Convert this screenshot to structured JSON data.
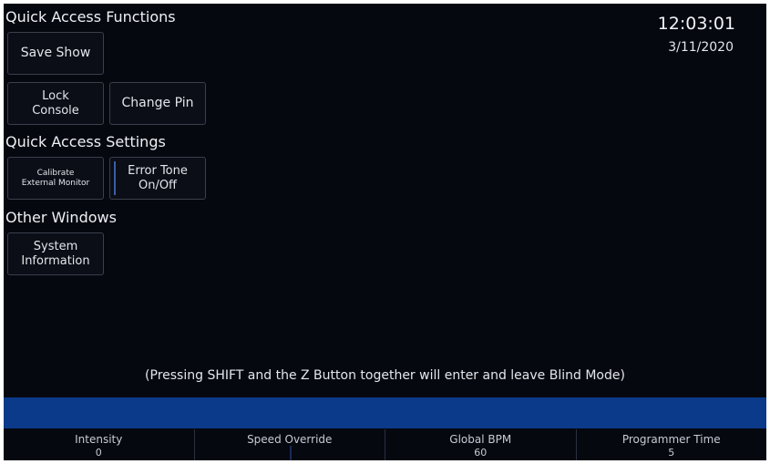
{
  "sections": {
    "quick_functions": "Quick Access Functions",
    "quick_settings": "Quick Access Settings",
    "other_windows": "Other Windows"
  },
  "buttons": {
    "save_show": "Save Show",
    "lock_console": [
      "Lock",
      "Console"
    ],
    "change_pin": "Change Pin",
    "calibrate": [
      "Calibrate",
      "External Monitor"
    ],
    "error_tone": [
      "Error Tone",
      "On/Off"
    ],
    "system_info": [
      "System",
      "Information"
    ]
  },
  "clock": {
    "time": "12:03:01",
    "date": "3/11/2020"
  },
  "hint": "(Pressing SHIFT and the Z Button together will enter and leave Blind Mode)",
  "status_bar": [
    {
      "label": "Intensity",
      "value": "0"
    },
    {
      "label": "Speed Override",
      "value": ""
    },
    {
      "label": "Global BPM",
      "value": "60"
    },
    {
      "label": "Programmer Time",
      "value": "5"
    }
  ],
  "colors": {
    "background": "#060810",
    "accent_bar": "#0b3a8a",
    "toggle_indicator": "#3a5ea8"
  }
}
